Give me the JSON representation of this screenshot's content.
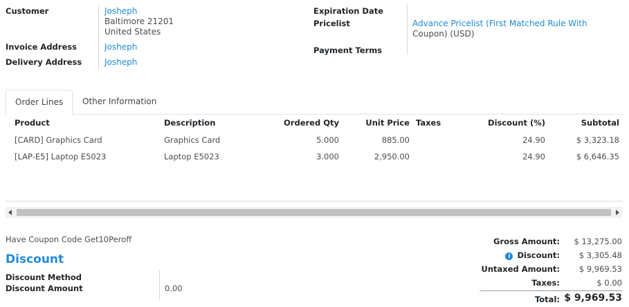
{
  "customer": {
    "label": "Customer",
    "name": "Josheph",
    "address_line1": "Baltimore 21201",
    "address_line2": "United States"
  },
  "invoice_address": {
    "label": "Invoice Address",
    "value": "Josheph"
  },
  "delivery_address": {
    "label": "Delivery Address",
    "value": "Josheph"
  },
  "expiration_date": {
    "label": "Expiration Date",
    "value": ""
  },
  "pricelist": {
    "label": "Pricelist",
    "value_line1": "Advance Pricelist (First Matched Rule With",
    "value_line2": "Coupon) (USD)"
  },
  "payment_terms": {
    "label": "Payment Terms",
    "value": ""
  },
  "tabs": [
    {
      "label": "Order Lines",
      "active": true
    },
    {
      "label": "Other Information",
      "active": false
    }
  ],
  "order_lines": {
    "columns": {
      "product": "Product",
      "description": "Description",
      "ordered_qty": "Ordered Qty",
      "unit_price": "Unit Price",
      "taxes": "Taxes",
      "discount": "Discount (%)",
      "subtotal": "Subtotal"
    },
    "rows": [
      {
        "product": "[CARD] Graphics Card",
        "description": "Graphics Card",
        "ordered_qty": "5.000",
        "unit_price": "885.00",
        "taxes": "",
        "discount": "24.90",
        "subtotal": "$ 3,323.18"
      },
      {
        "product": "[LAP-E5] Laptop E5023",
        "description": "Laptop E5023",
        "ordered_qty": "3.000",
        "unit_price": "2,950.00",
        "taxes": "",
        "discount": "24.90",
        "subtotal": "$ 6,646.35"
      }
    ]
  },
  "coupon_note": "Have Coupon Code Get10Peroff",
  "discount_section": {
    "title": "Discount",
    "method_label": "Discount Method",
    "method_value": "",
    "amount_label": "Discount Amount",
    "amount_value": "0.00"
  },
  "summary": {
    "gross_label": "Gross Amount:",
    "gross_value": "$ 13,275.00",
    "discount_label": "Discount:",
    "discount_value": "$ 3,305.48",
    "untaxed_label": "Untaxed Amount:",
    "untaxed_value": "$ 9,969.53",
    "taxes_label": "Taxes:",
    "taxes_value": "$ 0.00",
    "total_label": "Total:",
    "total_value": "$ 9,969.53"
  },
  "icons": {
    "info": "info-icon"
  },
  "colors": {
    "link": "#1f8ad8",
    "accent": "#1f8ad8"
  }
}
